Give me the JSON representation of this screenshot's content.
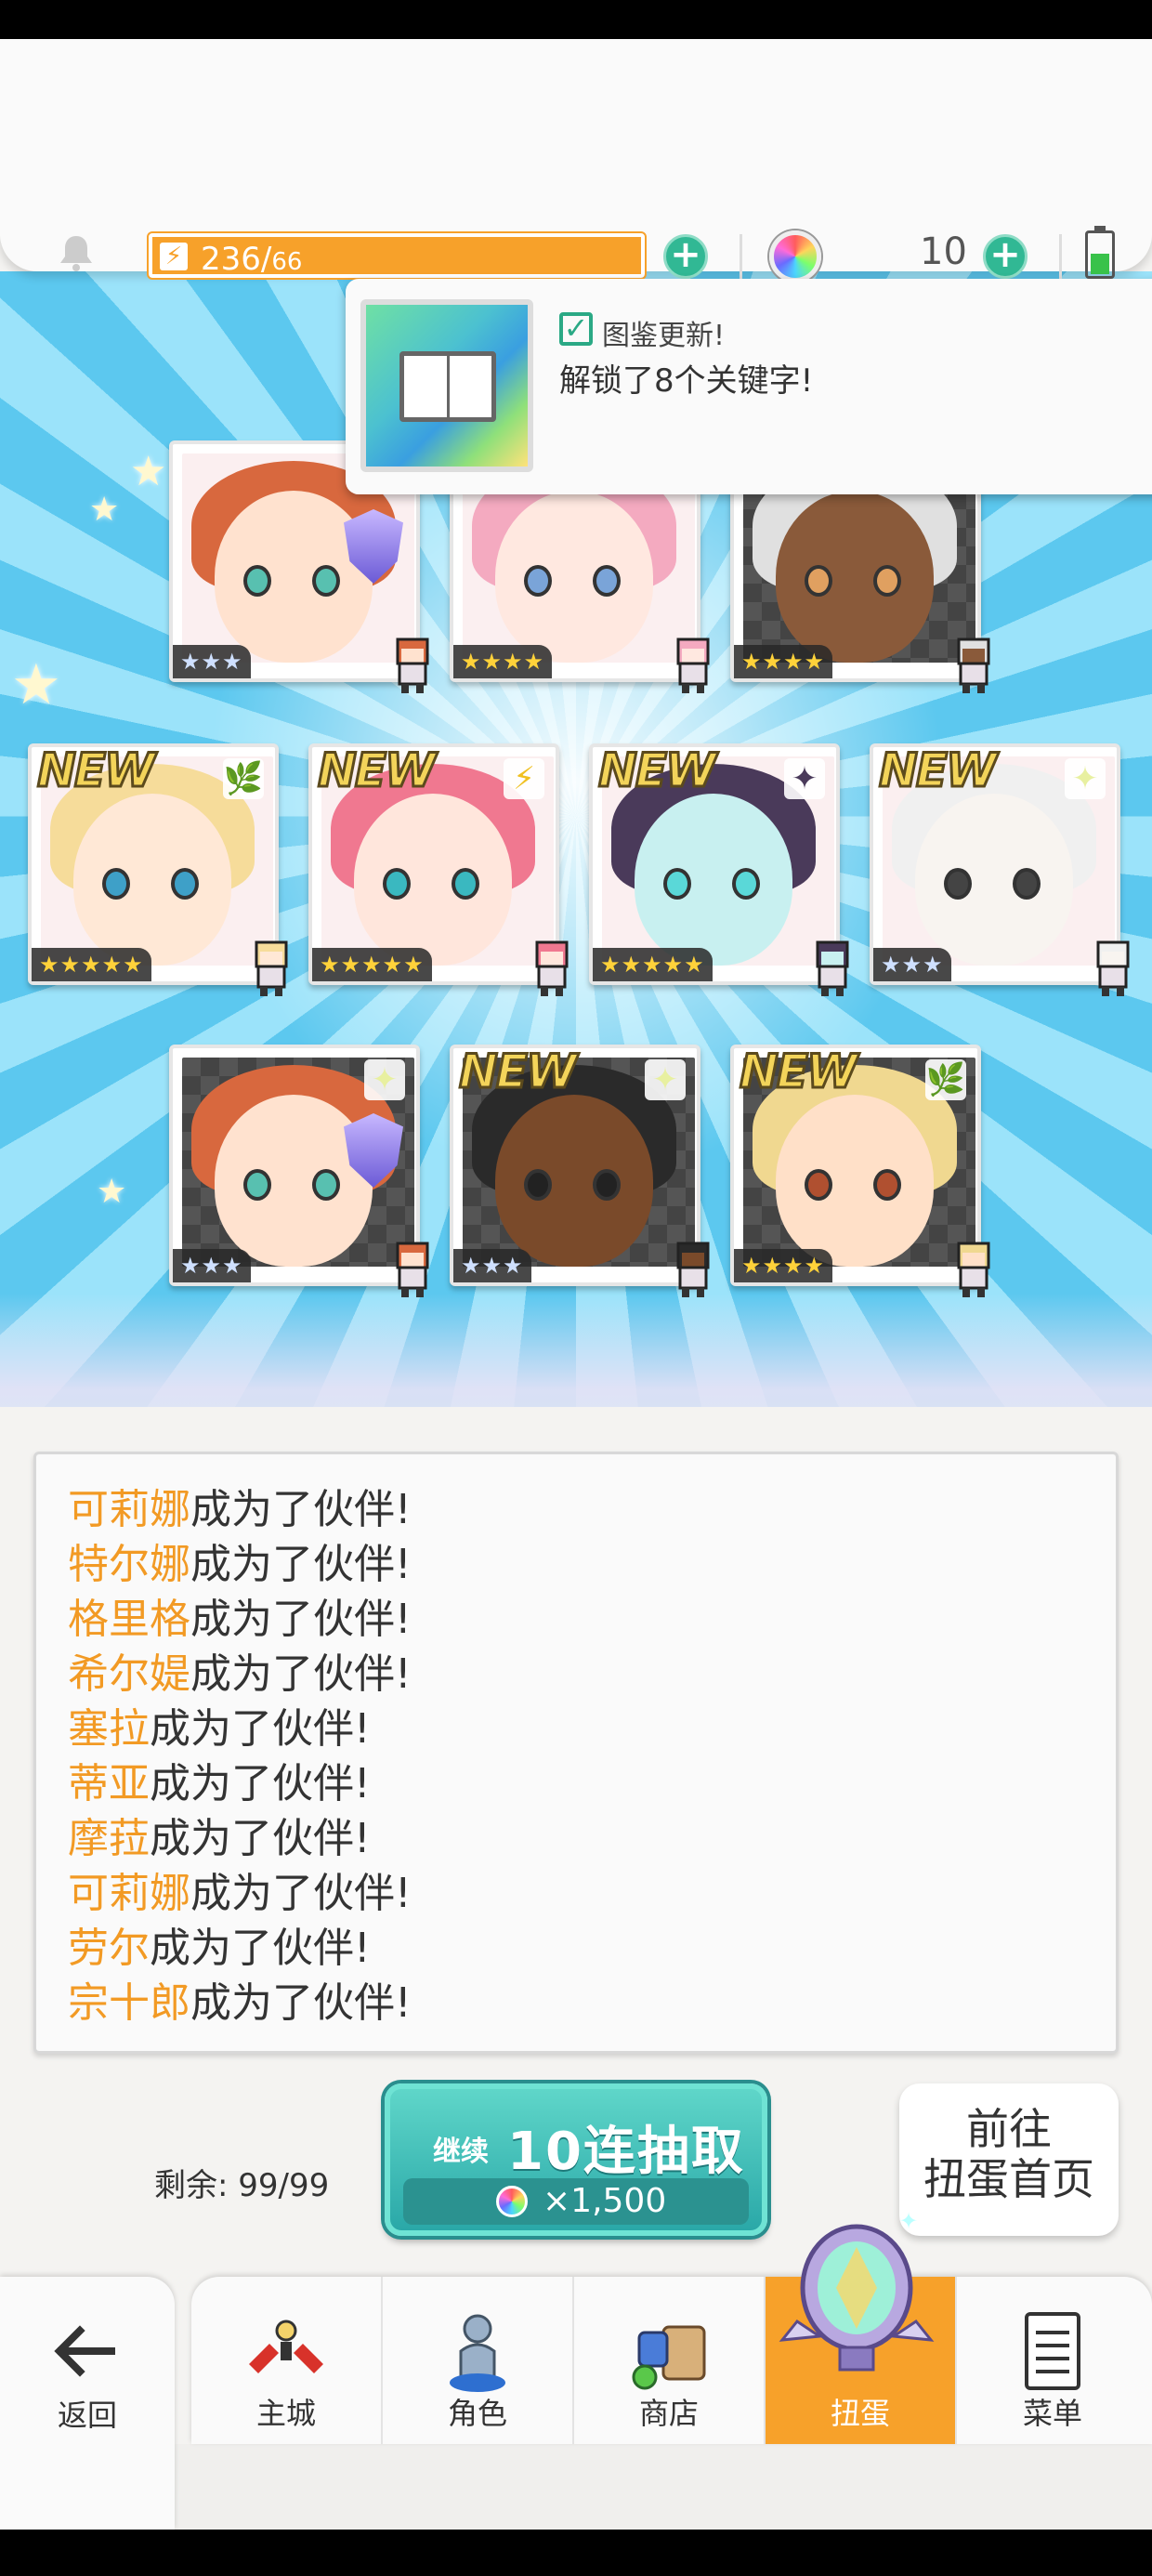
{
  "header": {
    "stamina": "236/",
    "stamina_max": "66",
    "gem_count": "10"
  },
  "notification": {
    "title": "图鉴更新!",
    "message": "解锁了8个关键字!"
  },
  "cards": [
    {
      "stars": "★★★",
      "new": false,
      "element": "",
      "colors": {
        "hair": "#d8683e",
        "skin": "#ffe2cf",
        "eye": "#58c0b0"
      }
    },
    {
      "stars": "★★★★",
      "new": false,
      "element": "",
      "colors": {
        "hair": "#f4aac0",
        "skin": "#ffe8e0",
        "eye": "#7aa4d8"
      }
    },
    {
      "stars": "★★★★",
      "new": false,
      "element": "",
      "colors": {
        "hair": "#e0e0e0",
        "skin": "#8a5a3a",
        "eye": "#e0a060"
      }
    },
    {
      "stars": "★★★★★",
      "new": true,
      "new_label": "NEW",
      "element": "leaf-icon",
      "colors": {
        "hair": "#f6dc9a",
        "skin": "#ffe8d6",
        "eye": "#3ea0c8"
      }
    },
    {
      "stars": "★★★★★",
      "new": true,
      "new_label": "NEW",
      "element": "lightning-icon",
      "colors": {
        "hair": "#f07890",
        "skin": "#ffe6dc",
        "eye": "#3ab8c0"
      }
    },
    {
      "stars": "★★★★★",
      "new": true,
      "new_label": "NEW",
      "element": "dark-star-icon",
      "colors": {
        "hair": "#4a3a5a",
        "skin": "#c8f0f0",
        "eye": "#5ad8d8"
      }
    },
    {
      "stars": "★★★",
      "new": true,
      "new_label": "NEW",
      "element": "light-star-icon",
      "colors": {
        "hair": "#f0f0f0",
        "skin": "#f8f4f0",
        "eye": "#444444"
      }
    },
    {
      "stars": "★★★",
      "new": false,
      "element": "light-star-icon",
      "colors": {
        "hair": "#d8683e",
        "skin": "#ffe2cf",
        "eye": "#58c0b0"
      }
    },
    {
      "stars": "★★★",
      "new": true,
      "new_label": "NEW",
      "element": "light-star-icon",
      "colors": {
        "hair": "#2a2a2a",
        "skin": "#7a4a2a",
        "eye": "#222222"
      }
    },
    {
      "stars": "★★★★",
      "new": true,
      "new_label": "NEW",
      "element": "leaf-icon",
      "colors": {
        "hair": "#f0d890",
        "skin": "#ffe0c8",
        "eye": "#b05030"
      }
    }
  ],
  "log": {
    "suffix": "成为了伙伴!",
    "entries": [
      "可莉娜",
      "特尔娜",
      "格里格",
      "希尔媞",
      "塞拉",
      "蒂亚",
      "摩菈",
      "可莉娜",
      "劳尔",
      "宗十郎"
    ]
  },
  "controls": {
    "remaining": "剩余: 99/99",
    "pull_prefix": "继续",
    "pull_label": "10连抽取",
    "pull_cost": "×1,500",
    "goto_label": "前往\n扭蛋首页"
  },
  "nav": {
    "back": "返回",
    "items": [
      {
        "label": "主城",
        "icon": "castle-icon",
        "active": false
      },
      {
        "label": "角色",
        "icon": "character-icon",
        "active": false
      },
      {
        "label": "商店",
        "icon": "shop-icon",
        "active": false
      },
      {
        "label": "扭蛋",
        "icon": "gacha-mirror-icon",
        "active": true
      },
      {
        "label": "菜单",
        "icon": "menu-icon",
        "active": false
      }
    ]
  },
  "colors": {
    "accent_orange": "#f7a12a",
    "teal": "#31b894",
    "name_highlight": "#f29a24"
  }
}
